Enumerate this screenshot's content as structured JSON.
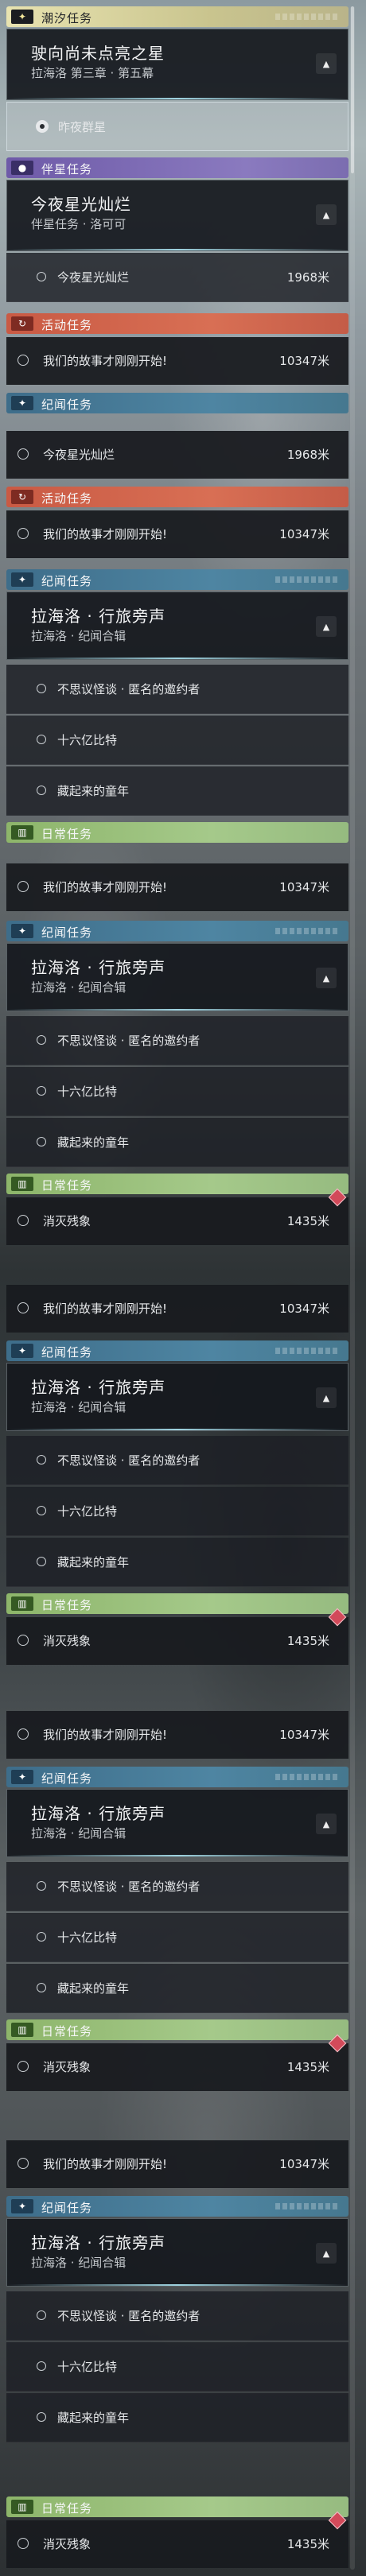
{
  "sections": {
    "chaoxi": "潮汐任务",
    "banxing": "伴星任务",
    "huodong": "活动任务",
    "jiwen": "纪闻任务",
    "richang": "日常任务"
  },
  "quests": {
    "chaoxi_main": {
      "title": "驶向尚未点亮之星",
      "sub": "拉海洛 第三章 · 第五幕"
    },
    "chaoxi_step": "昨夜群星",
    "banxing_main": {
      "title": "今夜星光灿烂",
      "sub": "伴星任务 · 洛可可"
    },
    "banxing_step": {
      "text": "今夜星光灿烂",
      "dist": "1968米"
    },
    "huodong_row": {
      "text": "我们的故事才刚刚开始!",
      "dist": "10347米"
    },
    "jiwen_row": {
      "text": "今夜星光灿烂",
      "dist": "1968米"
    },
    "jiwen_main": {
      "title": "拉海洛 · 行旅旁声",
      "sub": "拉海洛 · 纪闻合辑"
    },
    "jiwen_steps": [
      "不思议怪谈 · 匿名的邀约者",
      "十六亿比特",
      "藏起来的童年"
    ],
    "richang_row": {
      "text": "消灭残象",
      "dist": "1435米"
    }
  },
  "icons": {
    "chaoxi": "sparkle-icon",
    "banxing": "person-icon",
    "huodong": "refresh-icon",
    "jiwen": "sparkle-icon",
    "richang": "book-icon",
    "collapse": "chevron-up-icon",
    "target": "target-icon",
    "circle": "circle-icon",
    "gem": "gem-icon"
  }
}
